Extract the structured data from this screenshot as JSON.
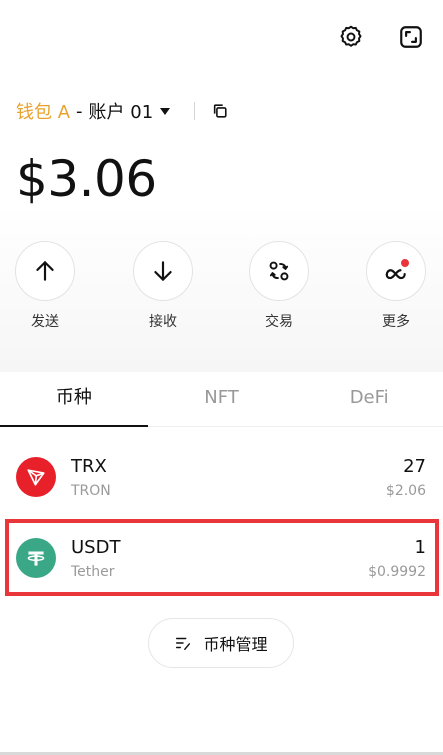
{
  "header": {
    "settings_icon": "gear-icon",
    "scan_icon": "scan-icon"
  },
  "wallet": {
    "name": "钱包 A",
    "separator": "-",
    "account": "账户 01",
    "accent_color": "#e8a230"
  },
  "balance": "$3.06",
  "actions": [
    {
      "label": "发送",
      "icon": "arrow-up-icon"
    },
    {
      "label": "接收",
      "icon": "arrow-down-icon"
    },
    {
      "label": "交易",
      "icon": "swap-icon"
    },
    {
      "label": "更多",
      "icon": "more-icon"
    }
  ],
  "tabs": [
    {
      "label": "币种",
      "active": true
    },
    {
      "label": "NFT",
      "active": false
    },
    {
      "label": "DeFi",
      "active": false
    }
  ],
  "tokens": [
    {
      "symbol": "TRX",
      "name": "TRON",
      "amount": "27",
      "value": "$2.06",
      "icon_color": "#e8202a",
      "icon": "tron-logo-icon"
    },
    {
      "symbol": "USDT",
      "name": "Tether",
      "amount": "1",
      "value": "$0.9992",
      "icon_color": "#3aa786",
      "icon": "tether-logo-icon"
    }
  ],
  "manage_button": {
    "label": "币种管理",
    "icon": "list-edit-icon"
  },
  "highlight_color": "#e8363b"
}
